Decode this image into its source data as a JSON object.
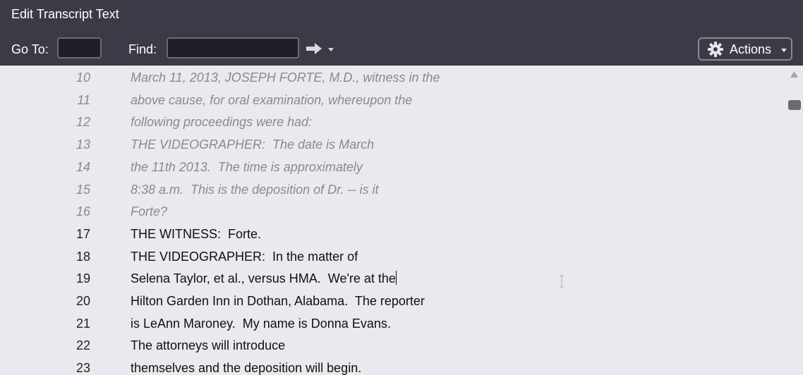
{
  "window": {
    "title": "Edit Transcript Text"
  },
  "toolbar": {
    "goto_label": "Go To:",
    "goto_value": "",
    "find_label": "Find:",
    "find_value": "",
    "find_next_icon": "arrow-right-icon",
    "find_options_icon": "caret-down-icon",
    "actions_label": "Actions",
    "actions_icon": "gear-icon"
  },
  "transcript": {
    "lines": [
      {
        "num": "10",
        "text": "March 11, 2013, JOSEPH FORTE, M.D., witness in the",
        "style": "prev"
      },
      {
        "num": "11",
        "text": "above cause, for oral examination, whereupon the",
        "style": "prev"
      },
      {
        "num": "12",
        "text": "following proceedings were had:",
        "style": "prev"
      },
      {
        "num": "13",
        "text": "THE VIDEOGRAPHER:  The date is March",
        "style": "prev"
      },
      {
        "num": "14",
        "text": "the 11th 2013.  The time is approximately",
        "style": "prev"
      },
      {
        "num": "15",
        "text": "8:38 a.m.  This is the deposition of Dr. -- is it",
        "style": "prev"
      },
      {
        "num": "16",
        "text": "Forte?",
        "style": "prev"
      },
      {
        "num": "17",
        "text": "THE WITNESS:  Forte.",
        "style": "current"
      },
      {
        "num": "18",
        "text": "THE VIDEOGRAPHER:  In the matter of",
        "style": "current"
      },
      {
        "num": "19",
        "text": "Selena Taylor, et al., versus HMA.  We're at the",
        "style": "current"
      },
      {
        "num": "20",
        "text": "Hilton Garden Inn in Dothan, Alabama.  The reporter",
        "style": "current"
      },
      {
        "num": "21",
        "text": "is LeAnn Maroney.  My name is Donna Evans.",
        "style": "current"
      },
      {
        "num": "22",
        "text": "The attorneys will introduce",
        "style": "current"
      },
      {
        "num": "23",
        "text": "themselves and the deposition will begin.",
        "style": "current"
      }
    ]
  },
  "scrollbar": {
    "up_icon": "scroll-up-arrow-icon"
  },
  "colors": {
    "titlebar": "#3b3b47",
    "editor_bg": "#e9e9ef",
    "prev_text": "#8a8a8e",
    "current_text": "#111111"
  }
}
